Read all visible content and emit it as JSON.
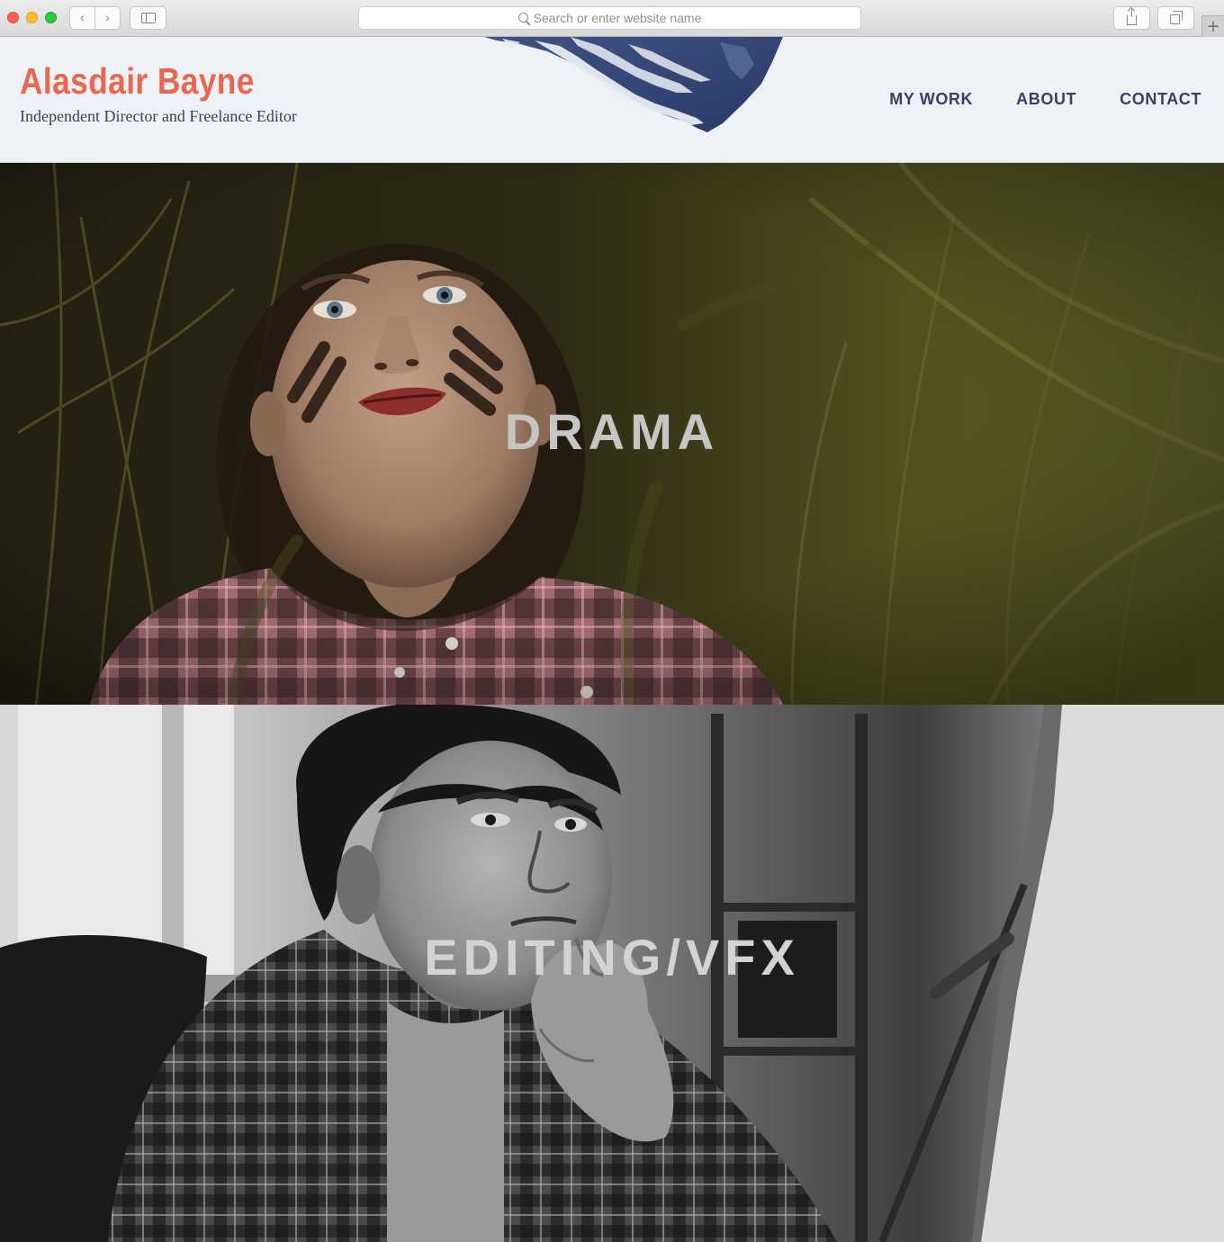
{
  "browser": {
    "address_placeholder": "Search or enter website name",
    "back_icon": "chevron-left-icon",
    "forward_icon": "chevron-right-icon",
    "new_tab_label": "+"
  },
  "header": {
    "title": "Alasdair Bayne",
    "tagline": "Independent Director and Freelance Editor",
    "nav": [
      {
        "label": "MY WORK"
      },
      {
        "label": "ABOUT"
      },
      {
        "label": "CONTACT"
      }
    ]
  },
  "panels": [
    {
      "label": "DRAMA"
    },
    {
      "label": "EDITING/VFX"
    }
  ],
  "colors": {
    "brand": "#e8674f",
    "nav_text": "#3a4062",
    "header_bg": "#eef2f6"
  }
}
